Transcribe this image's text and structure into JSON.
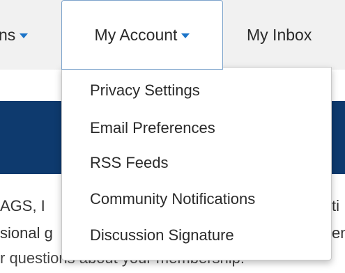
{
  "nav": {
    "prev_label_fragment": "ns",
    "account_label": "My Account",
    "inbox_label": "My Inbox"
  },
  "dropdown": {
    "items": [
      "Privacy Settings",
      "Email Preferences",
      "RSS Feeds",
      "Community Notifications",
      "Discussion Signature"
    ]
  },
  "page": {
    "line1": "AGS, I",
    "line2": "sional g",
    "line3": "r questions about your membership:",
    "line1_right": "ti",
    "line2_right": "em"
  },
  "colors": {
    "banner": "#0e3a6e",
    "caret": "#1a73c8",
    "nav_background": "#f1f1f1",
    "active_border": "#7da4cc"
  }
}
